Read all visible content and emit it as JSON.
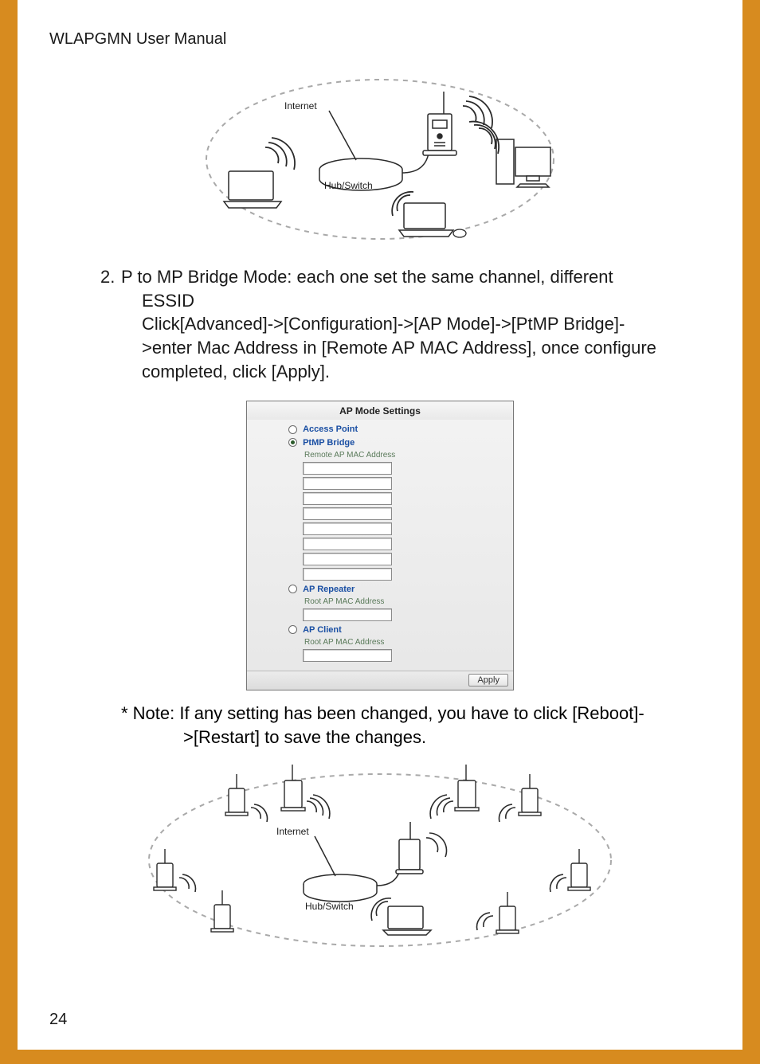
{
  "header": {
    "title": "WLAPGMN User Manual"
  },
  "figure1": {
    "internet_label": "Internet",
    "hub_label": "Hub/Switch"
  },
  "section2": {
    "num": "2.",
    "line1": "P to MP Bridge Mode: each one set the same channel, different",
    "line2": "ESSID",
    "line3": "Click[Advanced]->[Configuration]->[AP Mode]->[PtMP Bridge]-",
    "line4": ">enter Mac Address in [Remote AP MAC Address], once configure",
    "line5": "completed, click [Apply]."
  },
  "screenshot": {
    "title": "AP Mode Settings",
    "opt_access_point": "Access Point",
    "opt_ptmp_bridge": "PtMP Bridge",
    "remote_mac_label": "Remote AP MAC Address",
    "opt_ap_repeater": "AP Repeater",
    "root_mac_label1": "Root AP MAC Address",
    "opt_ap_client": "AP Client",
    "root_mac_label2": "Root AP MAC Address",
    "apply": "Apply"
  },
  "note": {
    "line1": "* Note: If any setting has been changed, you have to click [Reboot]-",
    "line2": ">[Restart] to save the changes."
  },
  "figure2": {
    "internet_label": "Internet",
    "hub_label": "Hub/Switch"
  },
  "page_number": "24"
}
